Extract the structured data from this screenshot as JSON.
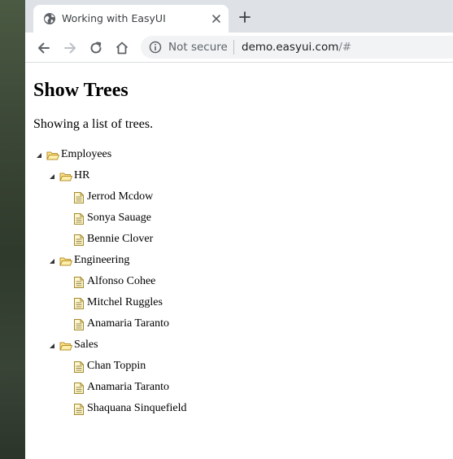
{
  "browser": {
    "tab_title": "Working with EasyUI",
    "security_label": "Not secure",
    "url_host": "demo.easyui.com",
    "url_path": "/#"
  },
  "page": {
    "title": "Show Trees",
    "description": "Showing a list of trees."
  },
  "tree": {
    "root": {
      "label": "Employees",
      "expanded": true,
      "groups": [
        {
          "label": "HR",
          "expanded": true,
          "items": [
            "Jerrod Mcdow",
            "Sonya Sauage",
            "Bennie Clover"
          ]
        },
        {
          "label": "Engineering",
          "expanded": true,
          "items": [
            "Alfonso Cohee",
            "Mitchel Ruggles",
            "Anamaria Taranto"
          ]
        },
        {
          "label": "Sales",
          "expanded": true,
          "items": [
            "Chan Toppin",
            "Anamaria Taranto",
            "Shaquana Sinquefield"
          ]
        }
      ]
    }
  },
  "colors": {
    "tab_strip": "#dee1e6",
    "omnibox": "#f1f3f4",
    "folder_fill": "#fbe38b",
    "folder_stroke": "#b8902c",
    "file_fill": "#fdf6cf",
    "file_stroke": "#a38a2c"
  }
}
